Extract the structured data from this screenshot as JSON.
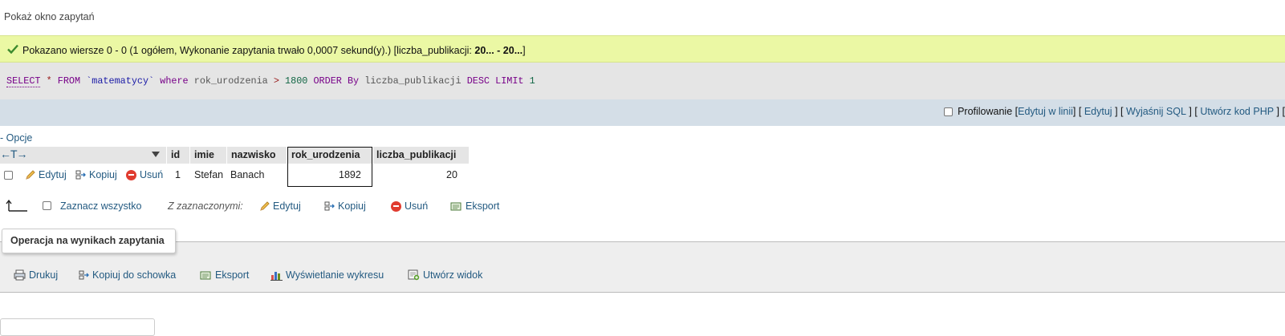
{
  "query_window_link": "Pokaż okno zapytań",
  "success": {
    "message_prefix": "Pokazano wiersze 0 - 0 (1 ogółem, Wykonanie zapytania trwało 0,0007 sekund(y).) [liczba_publikacji: ",
    "message_bold": "20... - 20...",
    "message_suffix": "]"
  },
  "sql": {
    "select": "SELECT",
    "star": "*",
    "from": "FROM",
    "table": "`matematycy`",
    "where": "where",
    "column": "rok_urodzenia",
    "gt": ">",
    "value": "1800",
    "order": "ORDER",
    "by": "By",
    "order_col": "liczba_publikacji",
    "desc": "DESC",
    "limit": "LIMIt",
    "limit_val": "1"
  },
  "profiling": {
    "label": "Profilowanie",
    "edit_inline": "Edytuj w linii",
    "edit": "Edytuj",
    "explain": "Wyjaśnij SQL",
    "create_php": "Utwórz kod PHP",
    "open": "[",
    "close": "]"
  },
  "options_link": "Opcje",
  "table": {
    "arrows": "←T→",
    "headers": [
      "id",
      "imie",
      "nazwisko",
      "rok_urodzenia",
      "liczba_publikacji"
    ],
    "row": {
      "edit": "Edytuj",
      "copy": "Kopiuj",
      "delete": "Usuń",
      "id": "1",
      "imie": "Stefan",
      "nazwisko": "Banach",
      "rok_urodzenia": "1892",
      "liczba_publikacji": "20"
    }
  },
  "bulk": {
    "select_all": "Zaznacz wszystko",
    "with_selected": "Z zaznaczonymi:",
    "edit": "Edytuj",
    "copy": "Kopiuj",
    "delete": "Usuń",
    "export": "Eksport"
  },
  "operations": {
    "title": "Operacja na wynikach zapytania",
    "print": "Drukuj",
    "copy_clipboard": "Kopiuj do schowka",
    "export": "Eksport",
    "chart": "Wyświetlanie wykresu",
    "create_view": "Utwórz widok"
  },
  "colors": {
    "link": "#235a81",
    "success_bg": "#ebf8a4",
    "sql_bg": "#e5e5e5",
    "profiling_bg": "#d4dee7"
  }
}
